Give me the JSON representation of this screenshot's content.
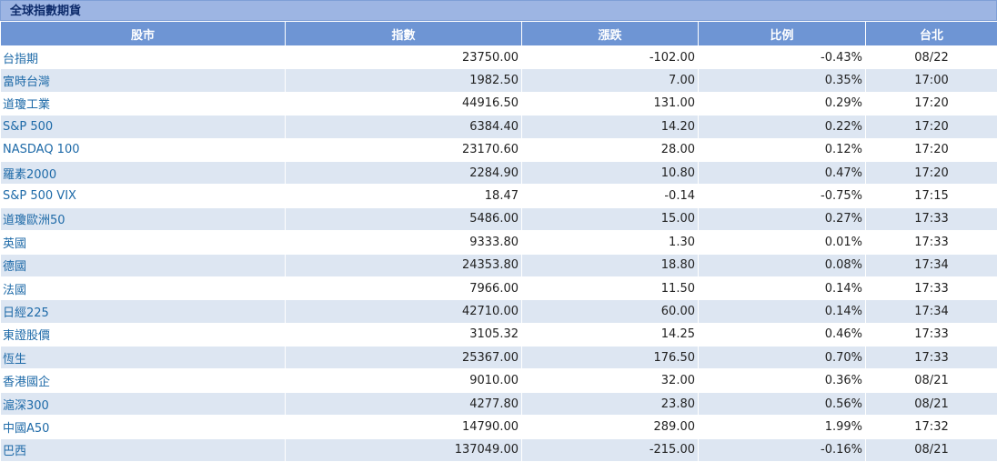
{
  "title": "全球指數期貨",
  "headers": {
    "market": "股市",
    "index": "指數",
    "change": "漲跌",
    "pct": "比例",
    "time": "台北"
  },
  "colors": {
    "up": "#e02b10",
    "down": "#1a7a3a",
    "header_bg": "#6e95d4",
    "title_bg": "#9db5e3",
    "alt_row": "#dde6f2"
  },
  "rows": [
    {
      "name": "台指期",
      "index": "23750.00",
      "change": "-102.00",
      "pct": "-0.43%",
      "time": "08/22",
      "dir": "down"
    },
    {
      "name": "富時台灣",
      "index": "1982.50",
      "change": "7.00",
      "pct": "0.35%",
      "time": "17:00",
      "dir": "up"
    },
    {
      "name": "道瓊工業",
      "index": "44916.50",
      "change": "131.00",
      "pct": "0.29%",
      "time": "17:20",
      "dir": "up"
    },
    {
      "name": "S&P 500",
      "index": "6384.40",
      "change": "14.20",
      "pct": "0.22%",
      "time": "17:20",
      "dir": "up"
    },
    {
      "name": "NASDAQ 100",
      "index": "23170.60",
      "change": "28.00",
      "pct": "0.12%",
      "time": "17:20",
      "dir": "up"
    },
    {
      "name": "羅素2000",
      "index": "2284.90",
      "change": "10.80",
      "pct": "0.47%",
      "time": "17:20",
      "dir": "up"
    },
    {
      "name": "S&P 500 VIX",
      "index": "18.47",
      "change": "-0.14",
      "pct": "-0.75%",
      "time": "17:15",
      "dir": "down"
    },
    {
      "name": "道瓊歐洲50",
      "index": "5486.00",
      "change": "15.00",
      "pct": "0.27%",
      "time": "17:33",
      "dir": "up"
    },
    {
      "name": "英國",
      "index": "9333.80",
      "change": "1.30",
      "pct": "0.01%",
      "time": "17:33",
      "dir": "up"
    },
    {
      "name": "德國",
      "index": "24353.80",
      "change": "18.80",
      "pct": "0.08%",
      "time": "17:34",
      "dir": "up"
    },
    {
      "name": "法國",
      "index": "7966.00",
      "change": "11.50",
      "pct": "0.14%",
      "time": "17:33",
      "dir": "up"
    },
    {
      "name": "日經225",
      "index": "42710.00",
      "change": "60.00",
      "pct": "0.14%",
      "time": "17:34",
      "dir": "up"
    },
    {
      "name": "東證股價",
      "index": "3105.32",
      "change": "14.25",
      "pct": "0.46%",
      "time": "17:33",
      "dir": "up"
    },
    {
      "name": "恆生",
      "index": "25367.00",
      "change": "176.50",
      "pct": "0.70%",
      "time": "17:33",
      "dir": "up"
    },
    {
      "name": "香港國企",
      "index": "9010.00",
      "change": "32.00",
      "pct": "0.36%",
      "time": "08/21",
      "dir": "up"
    },
    {
      "name": "滬深300",
      "index": "4277.80",
      "change": "23.80",
      "pct": "0.56%",
      "time": "08/21",
      "dir": "up"
    },
    {
      "name": "中國A50",
      "index": "14790.00",
      "change": "289.00",
      "pct": "1.99%",
      "time": "17:32",
      "dir": "up"
    },
    {
      "name": "巴西",
      "index": "137049.00",
      "change": "-215.00",
      "pct": "-0.16%",
      "time": "08/21",
      "dir": "down"
    }
  ]
}
